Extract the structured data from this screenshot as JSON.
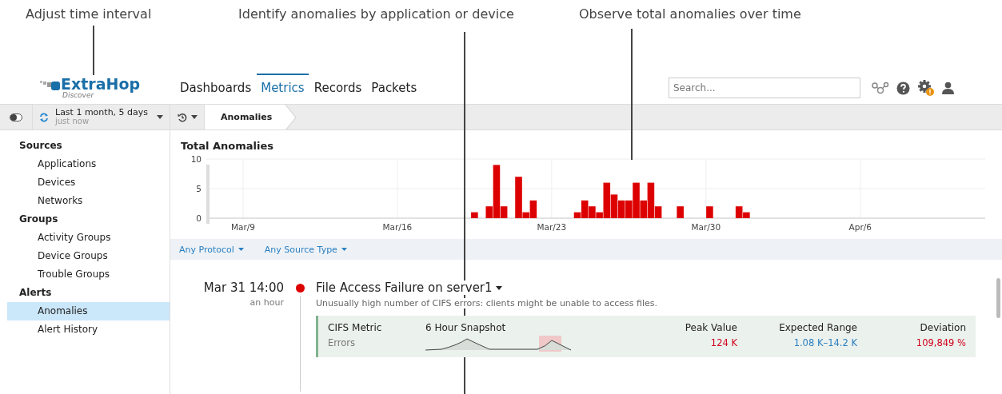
{
  "annotations": [
    {
      "text": "Adjust time interval"
    },
    {
      "text": "Identify anomalies by application or device"
    },
    {
      "text": "Observe total anomalies over time"
    }
  ],
  "header": {
    "logo": "ExtraHop",
    "logo_sub": "Discover",
    "nav": [
      {
        "label": "Dashboards",
        "selected": false
      },
      {
        "label": "Metrics",
        "selected": true
      },
      {
        "label": "Records",
        "selected": false
      },
      {
        "label": "Packets",
        "selected": false
      }
    ],
    "search": {
      "placeholder": "Search..."
    }
  },
  "toolbar": {
    "time_range": "Last 1 month, 5 days",
    "updated": "just now",
    "breadcrumb": "Anomalies"
  },
  "sidebar": [
    {
      "title": "Sources",
      "items": [
        {
          "label": "Applications",
          "selected": false
        },
        {
          "label": "Devices",
          "selected": false
        },
        {
          "label": "Networks",
          "selected": false
        }
      ]
    },
    {
      "title": "Groups",
      "items": [
        {
          "label": "Activity Groups",
          "selected": false
        },
        {
          "label": "Device Groups",
          "selected": false
        },
        {
          "label": "Trouble Groups",
          "selected": false
        }
      ]
    },
    {
      "title": "Alerts",
      "items": [
        {
          "label": "Anomalies",
          "selected": true
        },
        {
          "label": "Alert History",
          "selected": false
        }
      ]
    }
  ],
  "chart": {
    "title": "Total Anomalies",
    "chart_data": {
      "type": "bar",
      "categories": [
        null,
        null,
        null,
        null,
        null,
        "Mar/9",
        null,
        null,
        null,
        null,
        null,
        null,
        null,
        null,
        null,
        null,
        null,
        null,
        null,
        null,
        null,
        null,
        null,
        null,
        null,
        null,
        "Mar/16",
        null,
        null,
        null,
        null,
        null,
        null,
        null,
        null,
        null,
        null,
        null,
        null,
        null,
        null,
        null,
        null,
        null,
        null,
        null,
        null,
        "Mar/23",
        null,
        null,
        null,
        null,
        null,
        null,
        null,
        null,
        null,
        null,
        null,
        null,
        null,
        null,
        null,
        null,
        null,
        null,
        null,
        null,
        "Mar/30",
        null,
        null,
        null,
        null,
        null,
        null,
        null,
        null,
        null,
        null,
        null,
        null,
        null,
        null,
        null,
        null,
        null,
        null,
        null,
        null,
        "Apr/6",
        null,
        null,
        null,
        null,
        null,
        null,
        null,
        null,
        null,
        null,
        null,
        null,
        null,
        null,
        null,
        null
      ],
      "values": [
        null,
        null,
        null,
        null,
        null,
        null,
        null,
        null,
        null,
        null,
        null,
        null,
        null,
        null,
        null,
        null,
        null,
        null,
        null,
        null,
        null,
        null,
        null,
        null,
        null,
        null,
        null,
        null,
        null,
        null,
        null,
        null,
        null,
        null,
        null,
        null,
        1,
        null,
        2,
        9,
        2,
        null,
        7,
        1,
        3,
        null,
        null,
        null,
        null,
        null,
        1,
        3,
        2,
        1,
        6,
        4,
        3,
        3,
        6,
        3,
        6,
        2,
        null,
        null,
        2,
        null,
        null,
        null,
        2,
        null,
        null,
        null,
        2,
        1,
        null,
        null,
        null,
        null,
        null,
        null,
        null,
        null,
        null,
        null,
        null,
        null,
        null,
        null,
        null,
        null,
        null,
        null,
        null,
        null,
        null,
        null,
        null,
        null,
        null,
        null,
        null,
        null,
        null,
        null,
        null,
        null
      ],
      "grid": true,
      "ylim": [
        0,
        10
      ],
      "yticks": [
        0,
        5,
        10
      ]
    }
  },
  "filters": [
    "Any Protocol",
    "Any Source Type"
  ],
  "anomaly": {
    "time": "Mar 31 14:00",
    "ago": "an hour",
    "title": "File Access Failure on server1",
    "description": "Unusually high number of CIFS errors: clients might be unable to access files.",
    "headers": {
      "metric": "CIFS Metric",
      "snapshot": "6 Hour Snapshot",
      "peak": "Peak Value",
      "range": "Expected Range",
      "deviation": "Deviation"
    },
    "metric": "Errors",
    "peak": "124 K",
    "range": "1.08 K–14.2 K",
    "deviation": "109,849 %"
  }
}
